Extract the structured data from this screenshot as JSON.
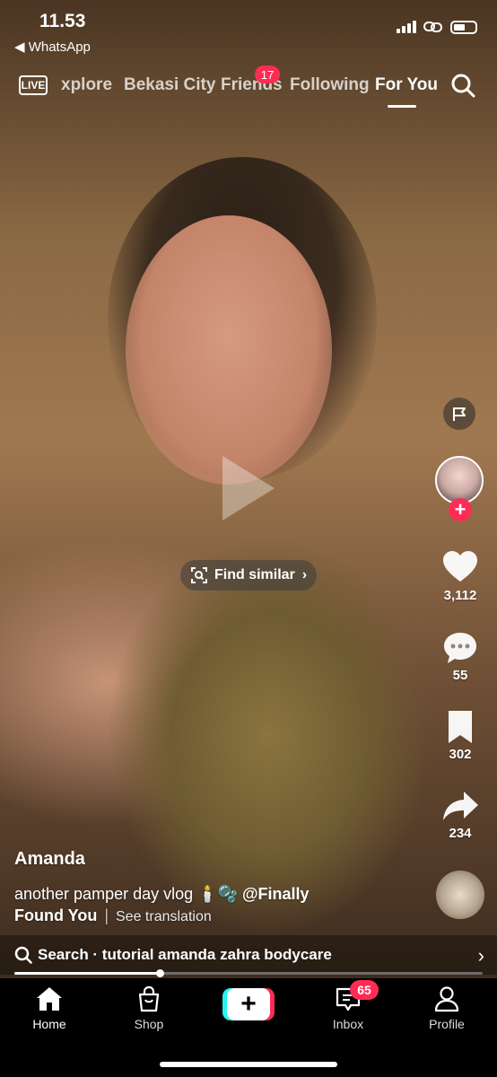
{
  "status_bar": {
    "time": "11.53",
    "back_app": "◀ WhatsApp"
  },
  "top_nav": {
    "live_label": "LIVE",
    "tabs": [
      {
        "label": "xplore",
        "active": false
      },
      {
        "label": "Bekasi City",
        "active": false
      },
      {
        "label": "Friends",
        "active": false,
        "badge": "17"
      },
      {
        "label": "Following",
        "active": false
      },
      {
        "label": "For You",
        "active": true
      }
    ]
  },
  "overlay": {
    "find_similar_label": "Find similar",
    "find_similar_chevron": "›"
  },
  "right_rail": {
    "likes": "3,112",
    "comments": "55",
    "saves": "302",
    "shares": "234"
  },
  "caption": {
    "author": "Amanda",
    "text_line1": "another pamper day vlog 🕯️🫧 ",
    "mention_part1": "@Finally",
    "mention_part2": "Found You",
    "separator": "|",
    "see_translation": "See translation"
  },
  "search_bar": {
    "text": "Search · tutorial amanda zahra bodycare",
    "chevron": "›"
  },
  "playback": {
    "progress_fraction": 0.31
  },
  "bottom_nav": {
    "home": "Home",
    "shop": "Shop",
    "create": "+",
    "inbox": "Inbox",
    "inbox_badge": "65",
    "profile": "Profile"
  },
  "colors": {
    "accent": "#fe2c55",
    "cyan": "#25f4ee"
  }
}
